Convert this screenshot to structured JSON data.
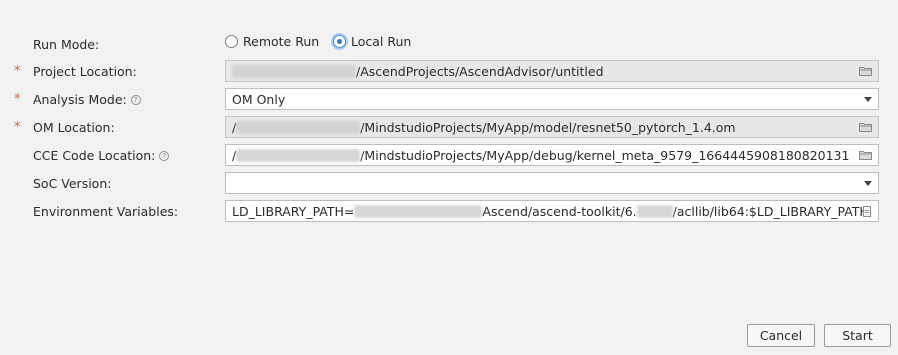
{
  "run_mode": {
    "label": "Run Mode:",
    "options": [
      "Remote Run",
      "Local Run"
    ],
    "selected": "Local Run"
  },
  "project_location": {
    "label": "Project Location:",
    "required": "*",
    "value_visible": "/AscendProjects/AscendAdvisor/untitled"
  },
  "analysis_mode": {
    "label": "Analysis Mode:",
    "required": "*",
    "help": "?",
    "value": "OM Only"
  },
  "om_location": {
    "label": "OM Location:",
    "required": "*",
    "value_prefix": "/",
    "value_visible": "/MindstudioProjects/MyApp/model/resnet50_pytorch_1.4.om"
  },
  "cce_code_location": {
    "label": "CCE Code Location:",
    "help": "?",
    "value_prefix": "/",
    "value_visible": "/MindstudioProjects/MyApp/debug/kernel_meta_9579_1664445908180820131"
  },
  "soc_version": {
    "label": "SoC Version:",
    "value": ""
  },
  "environment_variables": {
    "label": "Environment Variables:",
    "value_part1": "LD_LIBRARY_PATH=",
    "value_part2": "Ascend/ascend-toolkit/6.",
    "value_part3": "/acllib/lib64:$LD_LIBRARY_PATH"
  },
  "buttons": {
    "cancel": "Cancel",
    "start": "Start"
  },
  "icons": {
    "browse": "folder-icon",
    "dropdown": "chevron-down-icon",
    "env_editor": "document-icon"
  },
  "colors": {
    "required_star": "#e0632c",
    "radio_selected": "#3578c4"
  }
}
